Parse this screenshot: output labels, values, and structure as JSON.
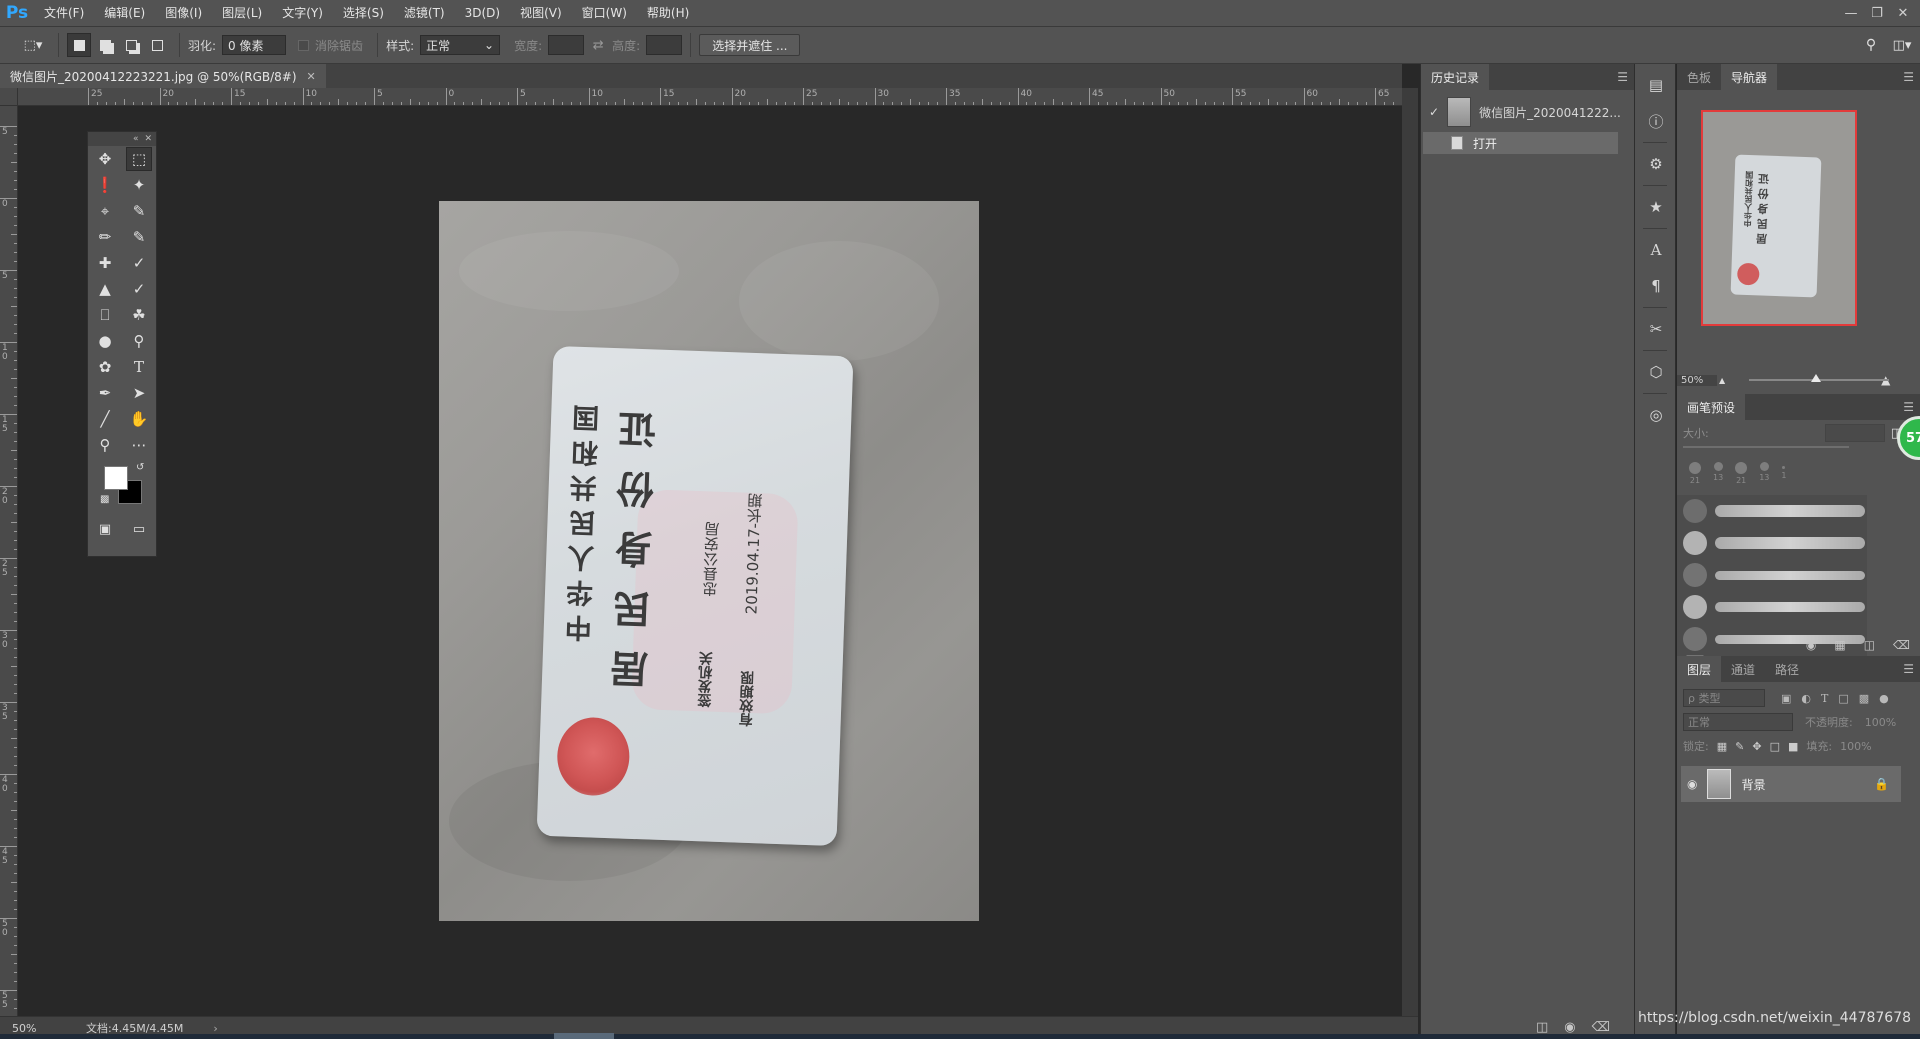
{
  "app": {
    "logo": "Ps"
  },
  "menu": [
    "文件(F)",
    "编辑(E)",
    "图像(I)",
    "图层(L)",
    "文字(Y)",
    "选择(S)",
    "滤镜(T)",
    "3D(D)",
    "视图(V)",
    "窗口(W)",
    "帮助(H)"
  ],
  "options": {
    "feather_label": "羽化:",
    "feather_value": "0 像素",
    "antialias_label": "消除锯齿",
    "style_label": "样式:",
    "style_value": "正常",
    "width_label": "宽度:",
    "height_label": "高度:",
    "select_mask_button": "选择并遮住 ..."
  },
  "document": {
    "tab_title": "微信图片_20200412223221.jpg @ 50%(RGB/8#)",
    "zoom": "50%",
    "doc_size": "文档:4.45M/4.45M"
  },
  "ruler_h_labels": [
    "25",
    "20",
    "15",
    "10",
    "5",
    "0",
    "5",
    "10",
    "15",
    "20",
    "25",
    "30",
    "35",
    "40",
    "45",
    "50",
    "55",
    "60",
    "65"
  ],
  "ruler_v_labels": [
    "5",
    "0",
    "5",
    "1 0",
    "1 5",
    "2 0",
    "2 5",
    "3 0",
    "3 5",
    "4 0",
    "4 5",
    "5 0",
    "5 5"
  ],
  "id_card": {
    "title_line1": "中华人民共和国",
    "title_line2": "居民身份证",
    "issuer_label": "签发机关",
    "issuer_value": "忠县公安局",
    "valid_label": "有效期限",
    "valid_value": "2019.04.17-长期"
  },
  "history": {
    "tabs": [
      "历史记录"
    ],
    "snapshot_name": "微信图片_2020041222...",
    "steps": [
      "打开"
    ]
  },
  "right_dock": {
    "top_tabs": [
      "色板",
      "导航器"
    ],
    "nav_zoom": "50%",
    "brush_tab": "画笔预设",
    "brush_size_label": "大小:",
    "brush_tip_sizes": [
      "21",
      "13",
      "21",
      "13",
      "1"
    ],
    "badge": "57",
    "layer_tabs": [
      "图层",
      "通道",
      "路径"
    ],
    "layer_kind": "ρ 类型",
    "blend_mode": "正常",
    "opacity_label": "不透明度:",
    "opacity_value": "100%",
    "lock_label": "锁定:",
    "fill_label": "填充:",
    "fill_value": "100%",
    "layer_name": "背景"
  },
  "watermark": "https://blog.csdn.net/weixin_44787678"
}
